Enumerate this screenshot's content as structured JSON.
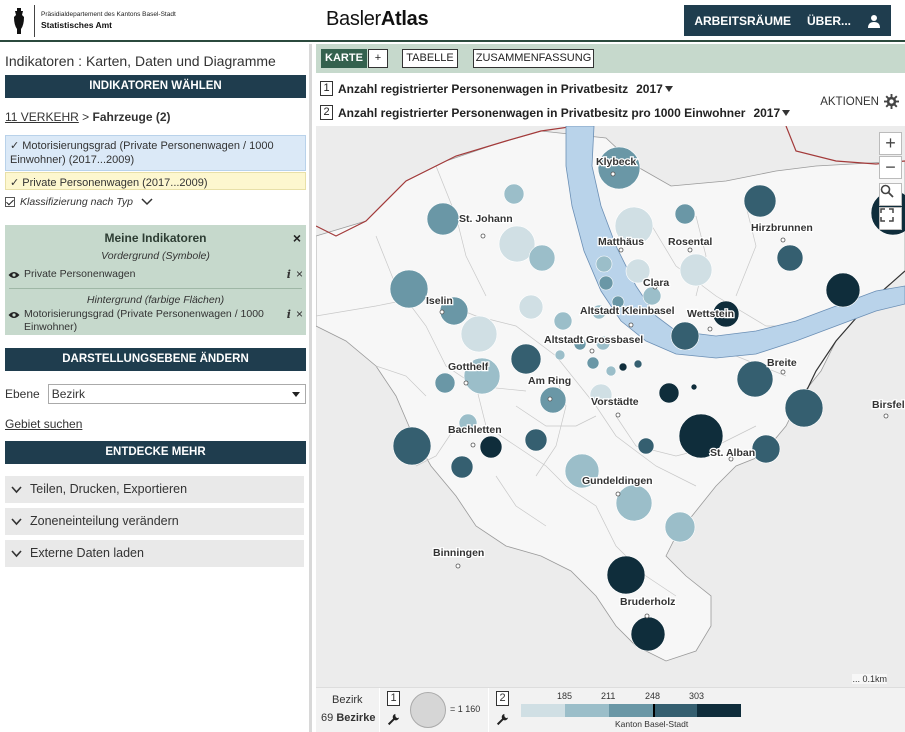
{
  "header": {
    "logo_line1": "Präsidialdepartement des Kantons Basel-Stadt",
    "logo_line2": "Statistisches Amt",
    "app_title_plain": "Basler",
    "app_title_bold": "Atlas",
    "nav": [
      "ARBEITSRÄUME",
      "ÜBER..."
    ]
  },
  "left": {
    "title": "Indikatoren : Karten, Daten und Diagramme",
    "sections": {
      "choose": "INDIKATOREN WÄHLEN",
      "level": "DARSTELLUNGSEBENE ÄNDERN",
      "discover": "ENTDECKE MEHR"
    },
    "breadcrumb": {
      "link": "11 VERKEHR",
      "sep": " > ",
      "current": "Fahrzeuge (2)"
    },
    "indicators": [
      "✓ Motorisierungsgrad (Private Personenwagen / 1000 Einwohner) (2017...2009)",
      "✓ Private Personenwagen (2017...2009)"
    ],
    "klassifizierung": "Klassifizierung nach Typ",
    "my_indicators": {
      "title": "Meine Indikatoren",
      "foreground_label": "Vordergrund (Symbole)",
      "foreground_item": "Private Personenwagen",
      "background_label": "Hintergrund (farbige Flächen)",
      "background_item": "Motorisierungsgrad (Private Personenwagen / 1000 Einwohner)",
      "info": "i",
      "close": "×"
    },
    "ebene": {
      "label": "Ebene",
      "value": "Bezirk"
    },
    "gebiet_link": "Gebiet suchen",
    "accordions": [
      "Teilen, Drucken, Exportieren",
      "Zoneneinteilung verändern",
      "Externe Daten laden"
    ]
  },
  "right": {
    "tabs": {
      "karte": "KARTE",
      "plus": "+",
      "tabelle": "TABELLE",
      "zusammenfassung": "ZUSAMMENFASSUNG"
    },
    "indicator_lines": [
      {
        "num": "1",
        "text": "Anzahl registrierter Personenwagen in Privatbesitz",
        "year": "2017"
      },
      {
        "num": "2",
        "text": "Anzahl registrierter Personenwagen in Privatbesitz pro 1000 Einwohner",
        "year": "2017"
      }
    ],
    "aktionen": "AKTIONEN",
    "map": {
      "labels": [
        "Klybeck",
        "St. Johann",
        "Matthäus",
        "Rosental",
        "Hirzbrunnen",
        "Clara",
        "Iselin",
        "Altstadt Kleinbasel",
        "Wettstein",
        "Altstadt Grossbasel",
        "Gotthelf",
        "Am Ring",
        "Breite",
        "Vorstädte",
        "Birsfelden",
        "Bachletten",
        "St. Alban",
        "Gundeldingen",
        "Binningen",
        "Bruderholz"
      ],
      "scale": "... 0.1km",
      "zoom_in": "+",
      "zoom_out": "−"
    },
    "legend": {
      "area_label": "Bezirk",
      "count_num": "69",
      "count_label": "Bezirke",
      "sym_num": "1",
      "circle_value": "= 1 160",
      "color_num": "2",
      "breaks": [
        "185",
        "211",
        "248",
        "303"
      ],
      "kanton": "Kanton Basel-Stadt",
      "colors": [
        "#d0dfe4",
        "#9bbec9",
        "#6a97a6",
        "#355f70",
        "#0f2d3b"
      ]
    }
  }
}
